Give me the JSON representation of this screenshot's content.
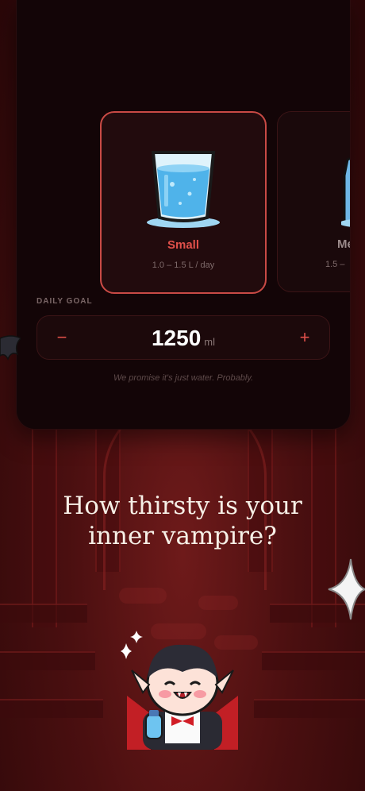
{
  "onboarding": {
    "options": [
      {
        "title": "Small",
        "range": "1.0 – 1.5 L / day",
        "icon": "glass-of-water-icon",
        "selected": true
      },
      {
        "title": "Me",
        "range": "1.5 –",
        "icon": "water-bottle-icon",
        "selected": false
      }
    ],
    "goal": {
      "label": "DAILY GOAL",
      "value": "1250",
      "unit": "ml",
      "decrement": "−",
      "increment": "+"
    },
    "tagline": "We promise it's just water. Probably.",
    "headline_line1": "How thirsty is your",
    "headline_line2": "inner vampire?"
  },
  "colors": {
    "accent": "#e0504a",
    "card_bg": "#130507",
    "background": "#4a0f10",
    "headline": "#f6efe6"
  },
  "icons": [
    "bat-wing-icon",
    "sparkle-icon",
    "vampire-mascot-icon"
  ]
}
